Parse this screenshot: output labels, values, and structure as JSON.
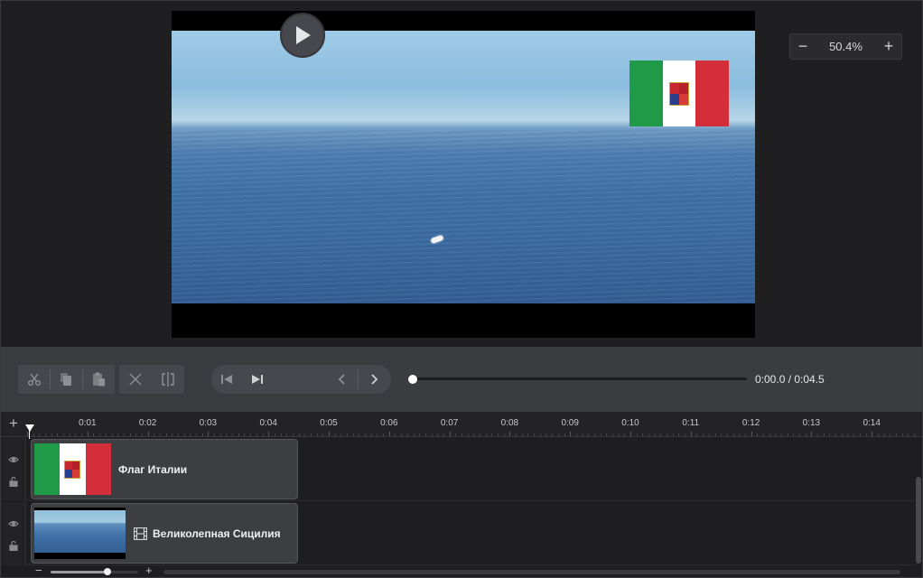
{
  "preview": {
    "zoom_value": "50.4%",
    "zoom_minus": "−",
    "zoom_plus": "+"
  },
  "toolbar": {
    "edit_buttons": [
      "cut-icon",
      "copy-icon",
      "paste-icon"
    ],
    "split_buttons": [
      "delete-icon",
      "split-icon"
    ],
    "transport_buttons": [
      "skip-to-start-icon",
      "next-frame-icon",
      "play-icon",
      "previous-icon",
      "next-icon"
    ],
    "timecode": "0:00.0 / 0:04.5",
    "progress": 0
  },
  "timeline": {
    "add_track": "+",
    "ruler_labels": [
      "0:01",
      "0:02",
      "0:03",
      "0:04",
      "0:05",
      "0:06",
      "0:07",
      "0:08",
      "0:09",
      "0:10",
      "0:11",
      "0:12",
      "0:13",
      "0:14"
    ],
    "tracks": [
      {
        "clip_label": "Флаг Италии",
        "thumb": "italy-flag"
      },
      {
        "clip_label": "Великолепная Сицилия",
        "thumb": "sea-video",
        "icon": "film-icon"
      }
    ],
    "zoom_minus": "−",
    "zoom_plus": "+",
    "zoom_level": 0.65
  },
  "colors": {
    "accent_white": "#ffffff",
    "flag_green": "#1f9b48",
    "flag_red": "#d42e3a",
    "panel": "#3a3c40"
  }
}
